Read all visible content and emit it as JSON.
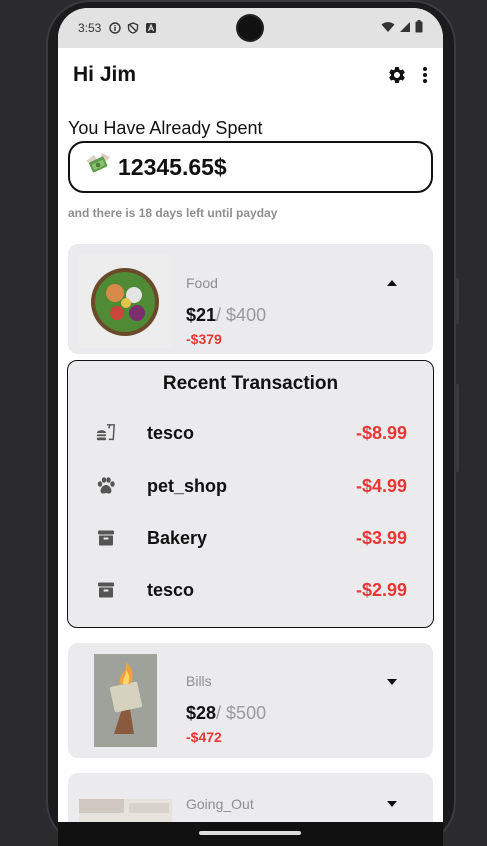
{
  "status": {
    "time": "3:53",
    "left_icons": [
      "info-icon",
      "shield-icon",
      "a-icon"
    ],
    "right_icons": [
      "wifi-icon",
      "signal-icon",
      "battery-icon"
    ]
  },
  "header": {
    "greeting": "Hi Jim"
  },
  "spending": {
    "label": "You Have Already Spent",
    "amount": "12345.65$",
    "payday_text": "and there is 18 days left until payday"
  },
  "categories": [
    {
      "name": "Food",
      "spent": "$21",
      "limit": "/ $400",
      "remaining": "-$379",
      "expanded": true
    },
    {
      "name": "Bills",
      "spent": "$28",
      "limit": "/ $500",
      "remaining": "-$472",
      "expanded": false
    },
    {
      "name": "Going_Out",
      "expanded": false
    }
  ],
  "recent": {
    "title": "Recent Transaction",
    "transactions": [
      {
        "icon": "fastfood-icon",
        "name": "tesco",
        "amount": "-$8.99"
      },
      {
        "icon": "paw-icon",
        "name": "pet_shop",
        "amount": "-$4.99"
      },
      {
        "icon": "archive-icon",
        "name": "Bakery",
        "amount": "-$3.99"
      },
      {
        "icon": "archive-icon",
        "name": "tesco",
        "amount": "-$2.99"
      }
    ]
  },
  "colors": {
    "negative": "#e53935",
    "card_bg": "#ebebed",
    "muted": "#8e8e8e"
  }
}
